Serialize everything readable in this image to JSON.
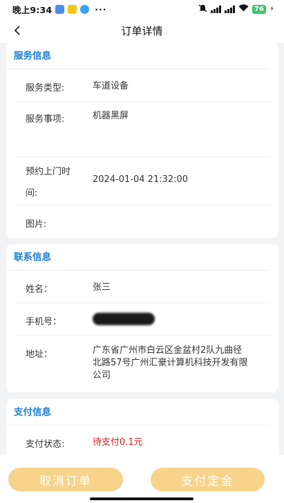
{
  "status_bar": {
    "time": "晚上9:34",
    "dots": "···",
    "battery": "76"
  },
  "nav": {
    "title": "订单详情"
  },
  "service": {
    "title": "服务信息",
    "type_label": "服务类型:",
    "type_value": "车道设备",
    "item_label": "服务事项:",
    "item_value": "机器黑屏",
    "visit_label_1": "预约上门时",
    "visit_label_2": "间:",
    "visit_value": "2024-01-04 21:32:00",
    "image_label": "图片:"
  },
  "contact": {
    "title": "联系信息",
    "name_label": "姓名：",
    "name_value": "张三",
    "phone_label": "手机号：",
    "address_label": "地址：",
    "address_line1": "广东省广州市白云区金盆村2队九曲径",
    "address_line2": "北路57号广州汇豪计算机科技开发有限",
    "address_line3": "公司"
  },
  "payment": {
    "title": "支付信息",
    "status_label": "支付状态:",
    "status_value": "待支付0.1元"
  },
  "actions": {
    "cancel_label": "取消订单",
    "pay_label": "支付定金"
  },
  "colors": {
    "accent": "#1e7fd0",
    "button_bg": "#f7d38c",
    "pay_status": "#d81e1e",
    "battery": "#3ec46d"
  }
}
